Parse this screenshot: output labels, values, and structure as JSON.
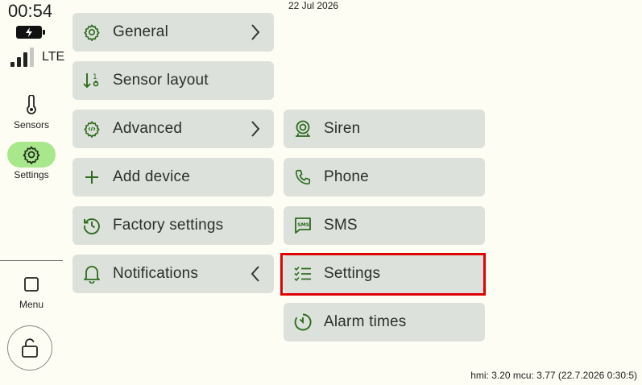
{
  "status": {
    "time": "00:54",
    "network": "LTE",
    "date": "22 Jul 2026",
    "signal_bars_filled": 3,
    "signal_bars_total": 4
  },
  "nav": {
    "sensors": "Sensors",
    "settings": "Settings",
    "menu": "Menu"
  },
  "menu_left": [
    {
      "label": "General",
      "icon": "gear-icon",
      "chevron": "right"
    },
    {
      "label": "Sensor layout",
      "icon": "sort-icon"
    },
    {
      "label": "Advanced",
      "icon": "code-gear-icon",
      "chevron": "right"
    },
    {
      "label": "Add device",
      "icon": "plus-icon"
    },
    {
      "label": "Factory settings",
      "icon": "history-icon"
    },
    {
      "label": "Notifications",
      "icon": "bell-icon",
      "chevron": "left"
    }
  ],
  "menu_right": [
    {
      "label": "Siren",
      "icon": "siren-icon"
    },
    {
      "label": "Phone",
      "icon": "phone-icon"
    },
    {
      "label": "SMS",
      "icon": "sms-icon"
    },
    {
      "label": "Settings",
      "icon": "checklist-icon",
      "highlighted": true
    },
    {
      "label": "Alarm times",
      "icon": "timer-icon"
    }
  ],
  "footer": "hmi: 3.20 mcu: 3.77 (22.7.2026 0:30:5)",
  "colors": {
    "accent": "#2e6b1f",
    "button_bg": "#dce2db",
    "active_pill": "#a9e78c",
    "highlight": "#e00000",
    "background": "#fdfdf3"
  }
}
